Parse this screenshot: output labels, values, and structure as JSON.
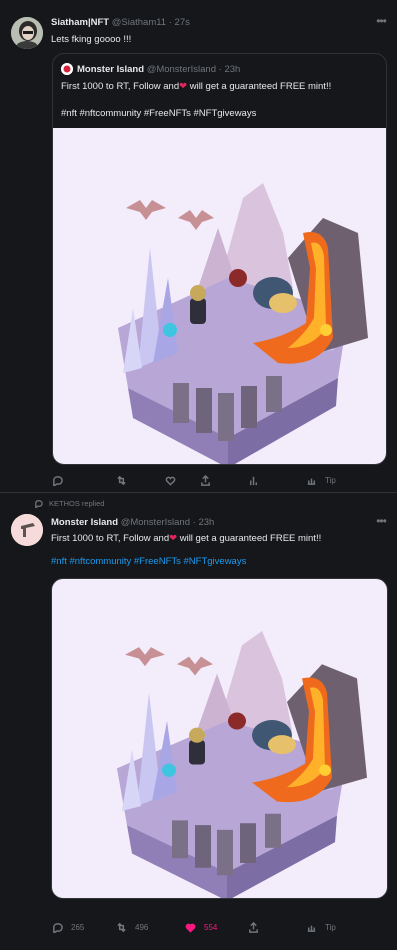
{
  "tweet1": {
    "author_name": "Siatham|NFT",
    "author_handle": "@Siatham11",
    "time": "27s",
    "text": "Lets fking goooo !!!",
    "quote": {
      "author_name": "Monster Island",
      "author_handle": "@MonsterIsland",
      "time": "23h",
      "text_before": "First 1000 to RT, Follow and",
      "text_after": " will get a guaranteed FREE mint!!",
      "hashtags": "#nft #nftcommunity #FreeNFTs #NFTgiveways"
    },
    "actions": {
      "reply": "",
      "retweet": "",
      "like": "",
      "tip": "Tip"
    }
  },
  "tweet2": {
    "context": "KETHOS replied",
    "author_name": "Monster Island",
    "author_handle": "@MonsterIsland",
    "time": "23h",
    "text_before": "First 1000 to RT, Follow and",
    "text_after": " will get a guaranteed FREE mint!!",
    "hashtags": "#nft #nftcommunity #FreeNFTs #NFTgiveways",
    "actions": {
      "reply": "265",
      "retweet": "496",
      "like": "554",
      "tip": "Tip"
    }
  },
  "icons": [
    "more-icon",
    "heart-emoji-icon",
    "reply-icon",
    "retweet-icon",
    "like-icon",
    "analytics-icon",
    "share-icon",
    "tip-icon",
    "reply-context-icon"
  ],
  "colors": {
    "background": "#15171a",
    "link": "#1d9bf0",
    "like": "#f91880",
    "muted": "#71767b"
  }
}
